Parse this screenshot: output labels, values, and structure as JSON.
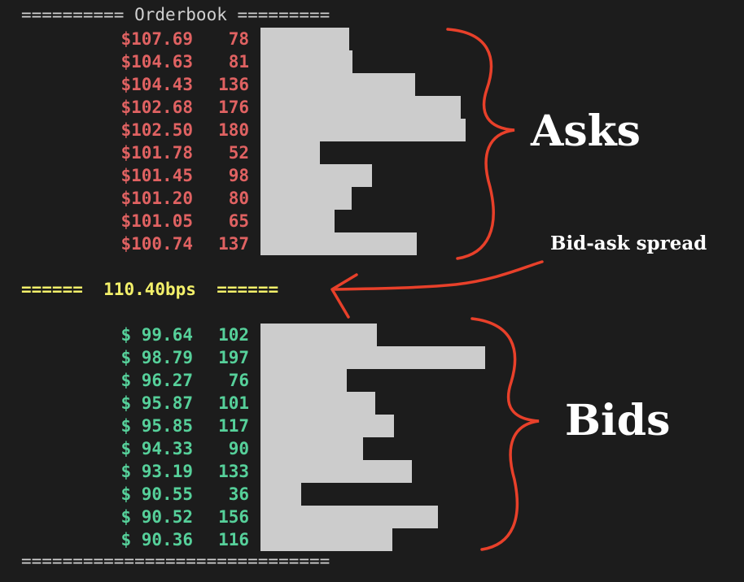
{
  "header": {
    "text": "========== Orderbook ========="
  },
  "footer": {
    "text": "=============================="
  },
  "orderbook": {
    "asks": [
      {
        "price": "$107.69",
        "qty": "78",
        "size": 78
      },
      {
        "price": "$104.63",
        "qty": "81",
        "size": 81
      },
      {
        "price": "$104.43",
        "qty": "136",
        "size": 136
      },
      {
        "price": "$102.68",
        "qty": "176",
        "size": 176
      },
      {
        "price": "$102.50",
        "qty": "180",
        "size": 180
      },
      {
        "price": "$101.78",
        "qty": "52",
        "size": 52
      },
      {
        "price": "$101.45",
        "qty": "98",
        "size": 98
      },
      {
        "price": "$101.20",
        "qty": "80",
        "size": 80
      },
      {
        "price": "$101.05",
        "qty": "65",
        "size": 65
      },
      {
        "price": "$100.74",
        "qty": "137",
        "size": 137
      }
    ],
    "spread": {
      "left": "======",
      "value": "110.40bps",
      "right": "======"
    },
    "bids": [
      {
        "price": "$ 99.64",
        "qty": "102",
        "size": 102
      },
      {
        "price": "$ 98.79",
        "qty": "197",
        "size": 197
      },
      {
        "price": "$ 96.27",
        "qty": "76",
        "size": 76
      },
      {
        "price": "$ 95.87",
        "qty": "101",
        "size": 101
      },
      {
        "price": "$ 95.85",
        "qty": "117",
        "size": 117
      },
      {
        "price": "$ 94.33",
        "qty": "90",
        "size": 90
      },
      {
        "price": "$ 93.19",
        "qty": "133",
        "size": 133
      },
      {
        "price": "$ 90.55",
        "qty": "36",
        "size": 36
      },
      {
        "price": "$ 90.52",
        "qty": "156",
        "size": 156
      },
      {
        "price": "$ 90.36",
        "qty": "116",
        "size": 116
      }
    ]
  },
  "annotations": {
    "asks_label": "Asks",
    "bids_label": "Bids",
    "spread_label": "Bid-ask spread"
  },
  "colors": {
    "background": "#1c1c1c",
    "ask": "#e06262",
    "bid": "#56d09a",
    "spread": "#f3f06a",
    "bar": "#cccccc",
    "annotation_stroke": "#e8402a"
  }
}
